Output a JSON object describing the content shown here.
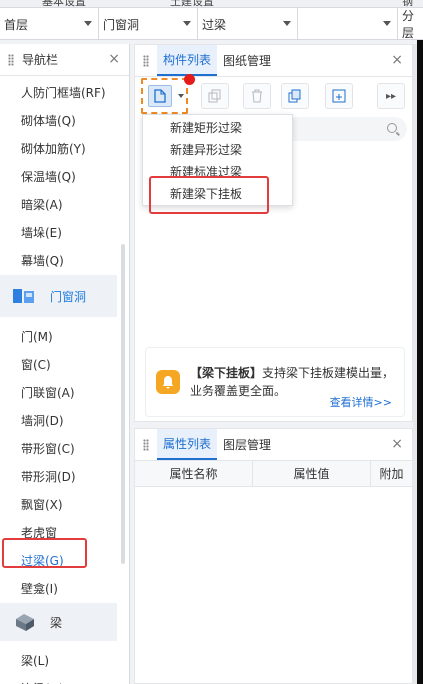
{
  "top_strip": [
    "基本设置",
    "土建设置",
    "钢筋"
  ],
  "filters": [
    {
      "value": "首层"
    },
    {
      "value": "门窗洞"
    },
    {
      "value": "过梁"
    },
    {
      "value": ""
    },
    {
      "value": "分层"
    }
  ],
  "nav": {
    "title": "导航栏",
    "items_before": [
      "人防门框墙(RF)",
      "砌体墙(Q)",
      "砌体加筋(Y)",
      "保温墙(Q)",
      "暗梁(A)",
      "墙垛(E)",
      "幕墙(Q)"
    ],
    "category_door": "门窗洞",
    "items_door": [
      "门(M)",
      "窗(C)",
      "门联窗(A)",
      "墙洞(D)",
      "带形窗(C)",
      "带形洞(D)",
      "飘窗(X)",
      "老虎窗",
      "过梁(G)",
      "壁龛(I)"
    ],
    "category_beam": "梁",
    "items_beam": [
      "梁(L)",
      "连梁(G)"
    ]
  },
  "component_panel": {
    "tabs": [
      "构件列表",
      "图纸管理"
    ],
    "menu": [
      "新建矩形过梁",
      "新建异形过梁",
      "新建标准过梁",
      "新建梁下挂板"
    ],
    "tip": {
      "title": "【梁下挂板】",
      "body": "支持梁下挂板建模出量，业务覆盖更全面。",
      "link": "查看详情>>"
    }
  },
  "property_panel": {
    "tabs": [
      "属性列表",
      "图层管理"
    ],
    "columns": [
      "属性名称",
      "属性值",
      "附加"
    ]
  },
  "colors": {
    "accent": "#1f6fd1",
    "highlight": "#e23c3c",
    "orange": "#f5a623"
  }
}
